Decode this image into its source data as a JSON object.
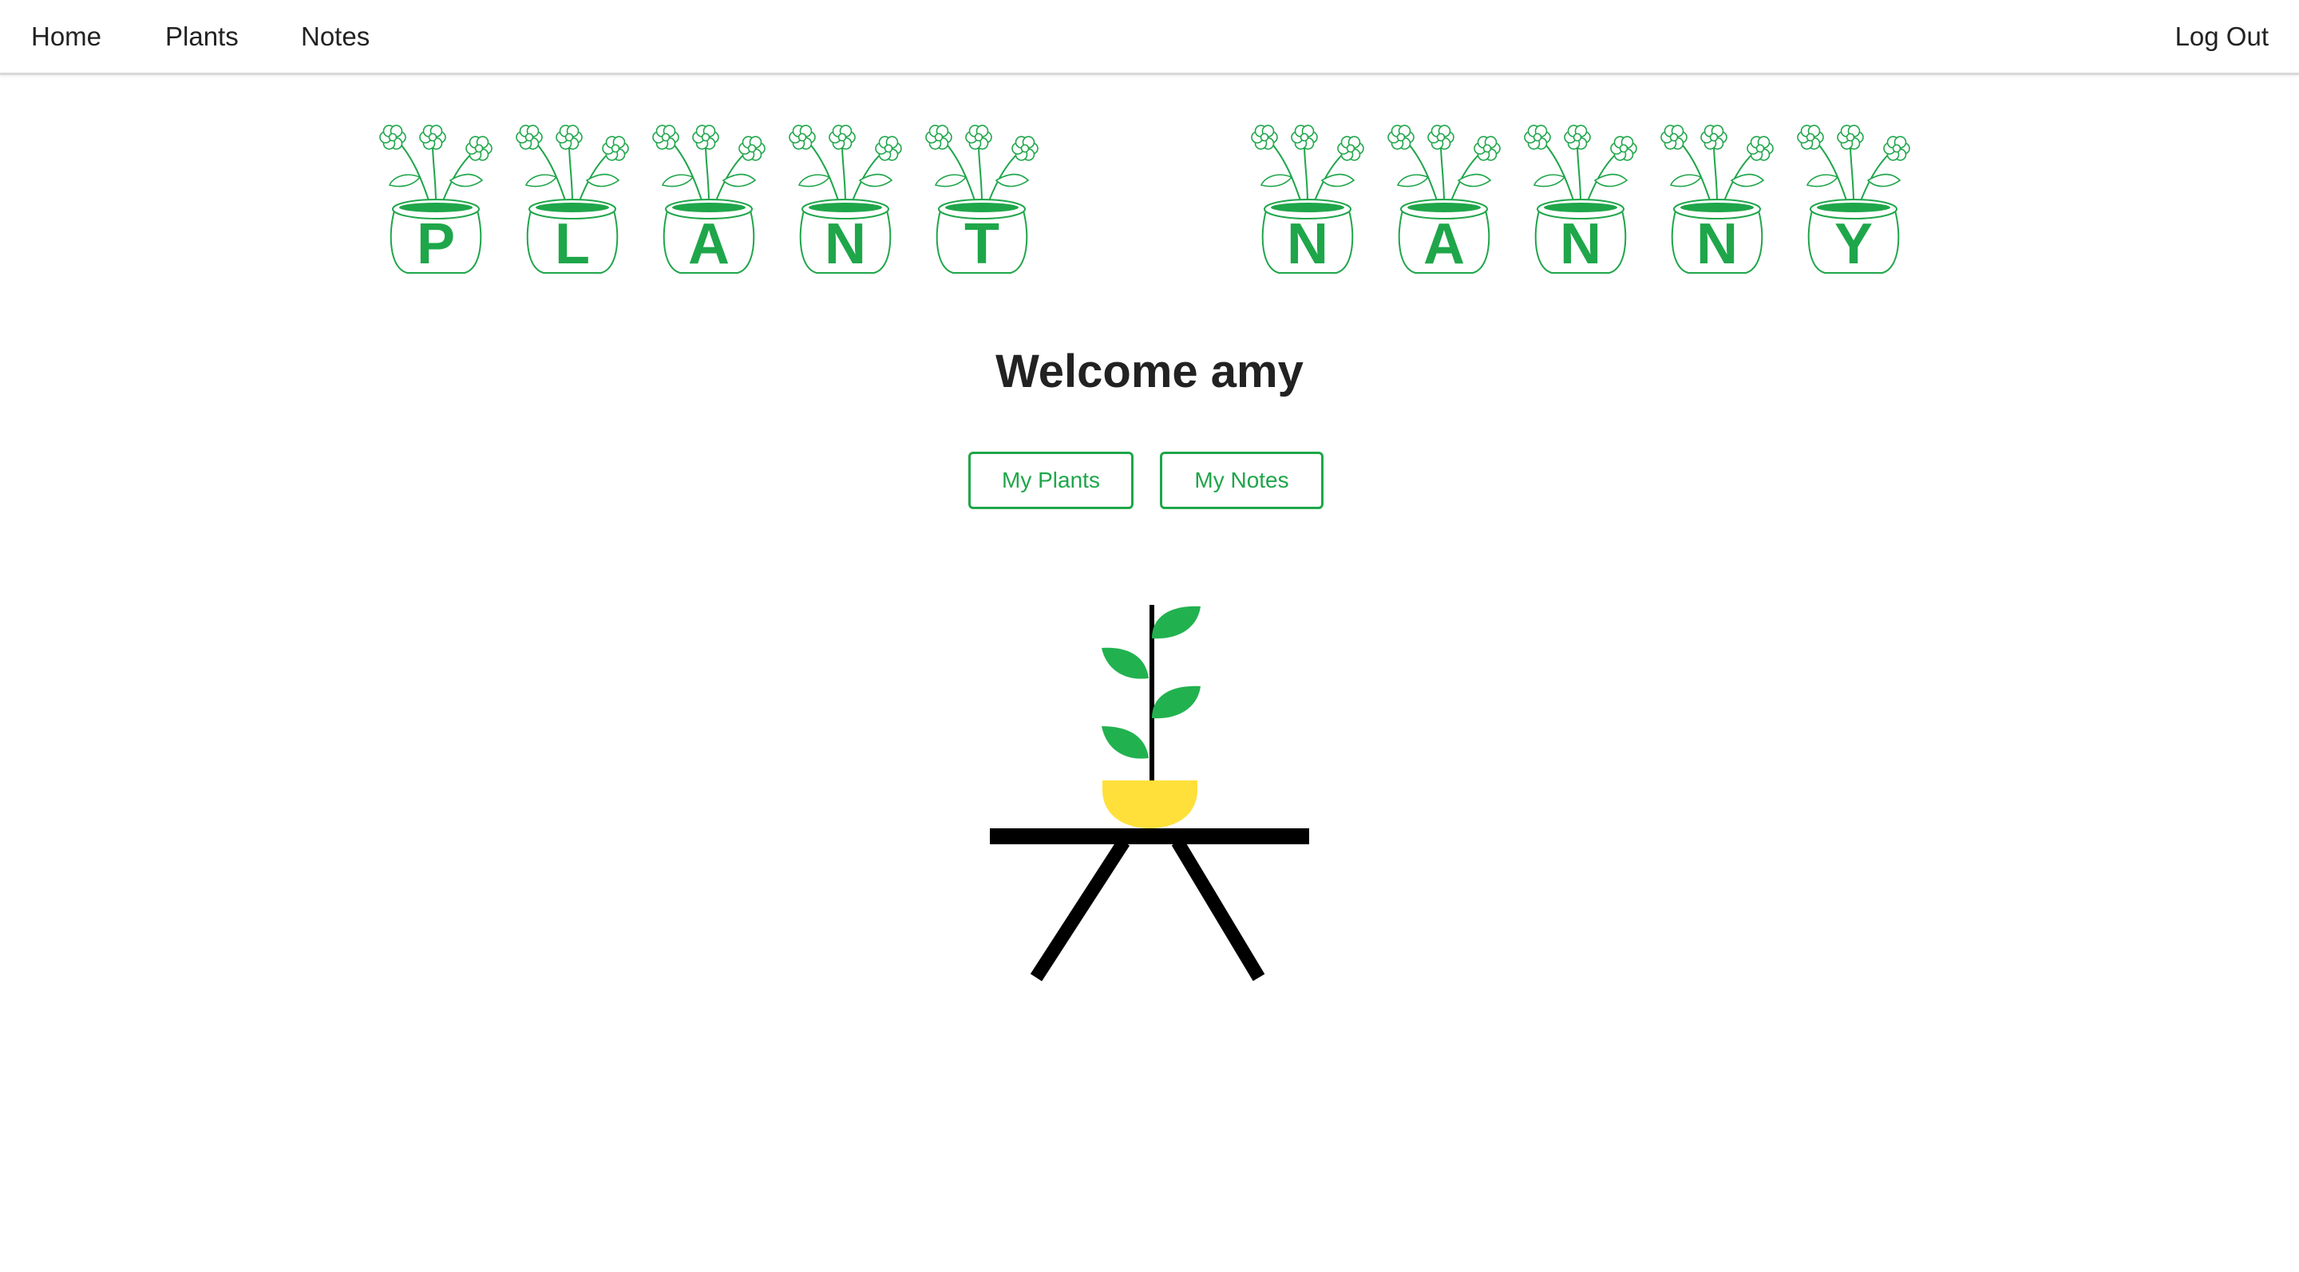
{
  "nav": {
    "home": "Home",
    "plants": "Plants",
    "notes": "Notes",
    "logout": "Log Out"
  },
  "logo": {
    "letters": [
      "P",
      "L",
      "A",
      "N",
      "T",
      "N",
      "A",
      "N",
      "N",
      "Y"
    ],
    "color": "#1fa64a"
  },
  "welcome": {
    "text": "Welcome amy"
  },
  "buttons": {
    "my_plants": "My Plants",
    "my_notes": "My Notes"
  },
  "colors": {
    "accent": "#1fa64a",
    "leaf": "#21b24f",
    "pot": "#ffe03a",
    "table": "#000000"
  }
}
